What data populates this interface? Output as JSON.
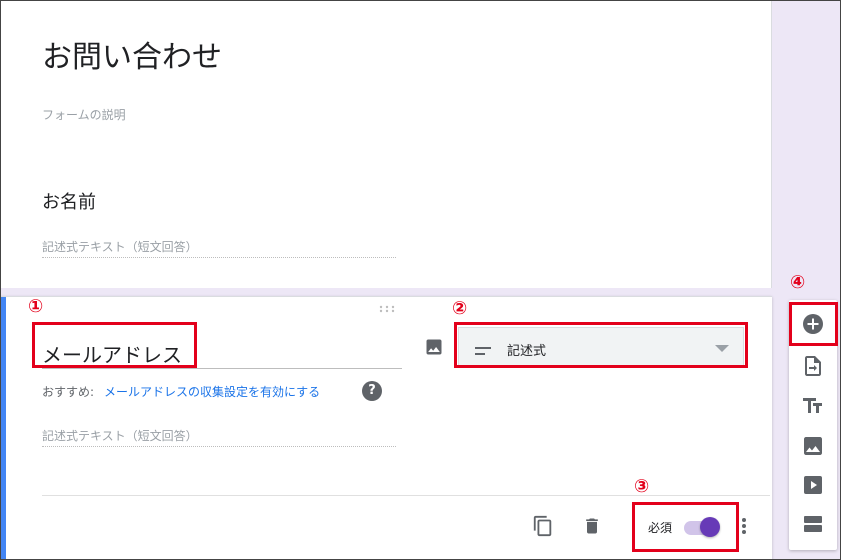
{
  "form": {
    "title": "お問い合わせ",
    "description_placeholder": "フォームの説明"
  },
  "question1": {
    "title": "お名前",
    "answer_placeholder": "記述式テキスト（短文回答）"
  },
  "question2": {
    "title": "メールアドレス",
    "type_label": "記述式",
    "suggest_label": "おすすめ:",
    "suggest_link": "メールアドレスの収集設定を有効にする",
    "help_glyph": "?",
    "answer_placeholder": "記述式テキスト（短文回答）",
    "required_label": "必須",
    "required": true
  },
  "drag_handle_glyph": "⠿",
  "toolbar": {
    "items": [
      "add-question-icon",
      "import-questions-icon",
      "add-title-icon",
      "add-image-icon",
      "add-video-icon",
      "add-section-icon"
    ]
  },
  "annotations": {
    "n1": "①",
    "n2": "②",
    "n3": "③",
    "n4": "④",
    "color": "#e3001b"
  },
  "colors": {
    "accent_purple": "#673ab7",
    "accent_blue": "#4285f4",
    "link_blue": "#1a73e8",
    "background": "#ede7f6"
  }
}
